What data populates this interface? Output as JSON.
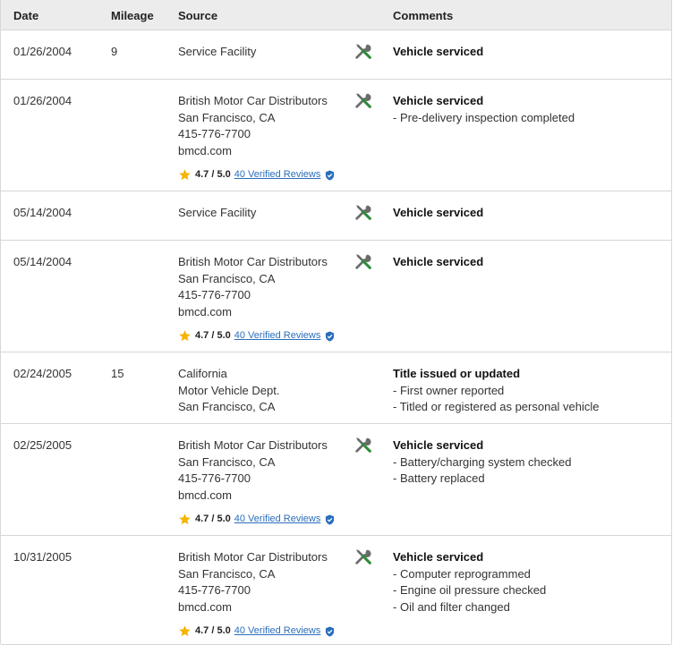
{
  "header": {
    "date": "Date",
    "mileage": "Mileage",
    "source": "Source",
    "comments": "Comments"
  },
  "rows": [
    {
      "date": "01/26/2004",
      "mileage": "9",
      "source": [
        "Service Facility"
      ],
      "icon": "wrench-screwdriver-icon",
      "comment_title": "Vehicle serviced",
      "comment_items": []
    },
    {
      "date": "01/26/2004",
      "mileage": "",
      "source": [
        "British Motor Car Distributors",
        "San Francisco, CA",
        "415-776-7700",
        "bmcd.com"
      ],
      "rating": {
        "score": "4.7 / 5.0",
        "reviews": "40 Verified Reviews"
      },
      "icon": "wrench-screwdriver-icon",
      "comment_title": "Vehicle serviced",
      "comment_items": [
        "Pre-delivery inspection completed"
      ]
    },
    {
      "date": "05/14/2004",
      "mileage": "",
      "source": [
        "Service Facility"
      ],
      "icon": "wrench-screwdriver-icon",
      "comment_title": "Vehicle serviced",
      "comment_items": []
    },
    {
      "date": "05/14/2004",
      "mileage": "",
      "source": [
        "British Motor Car Distributors",
        "San Francisco, CA",
        "415-776-7700",
        "bmcd.com"
      ],
      "rating": {
        "score": "4.7 / 5.0",
        "reviews": "40 Verified Reviews"
      },
      "icon": "wrench-screwdriver-icon",
      "comment_title": "Vehicle serviced",
      "comment_items": []
    },
    {
      "date": "02/24/2005",
      "mileage": "15",
      "source": [
        "California",
        "Motor Vehicle Dept.",
        "San Francisco, CA"
      ],
      "comment_title": "Title issued or updated",
      "comment_items": [
        "First owner reported",
        "Titled or registered as personal vehicle"
      ]
    },
    {
      "date": "02/25/2005",
      "mileage": "",
      "source": [
        "British Motor Car Distributors",
        "San Francisco, CA",
        "415-776-7700",
        "bmcd.com"
      ],
      "rating": {
        "score": "4.7 / 5.0",
        "reviews": "40 Verified Reviews"
      },
      "icon": "wrench-screwdriver-icon",
      "comment_title": "Vehicle serviced",
      "comment_items": [
        "Battery/charging system checked",
        "Battery replaced"
      ]
    },
    {
      "date": "10/31/2005",
      "mileage": "",
      "source": [
        "British Motor Car Distributors",
        "San Francisco, CA",
        "415-776-7700",
        "bmcd.com"
      ],
      "rating": {
        "score": "4.7 / 5.0",
        "reviews": "40 Verified Reviews"
      },
      "icon": "wrench-screwdriver-icon",
      "comment_title": "Vehicle serviced",
      "comment_items": [
        "Computer reprogrammed",
        "Engine oil pressure checked",
        "Oil and filter changed"
      ]
    }
  ],
  "colors": {
    "header_bg": "#ececec",
    "link": "#2a6ebb",
    "star": "#f5b400",
    "wrench_gray": "#6b6b6b",
    "screwdriver_green": "#2e8b3a",
    "verified": "#2a6ebb"
  }
}
